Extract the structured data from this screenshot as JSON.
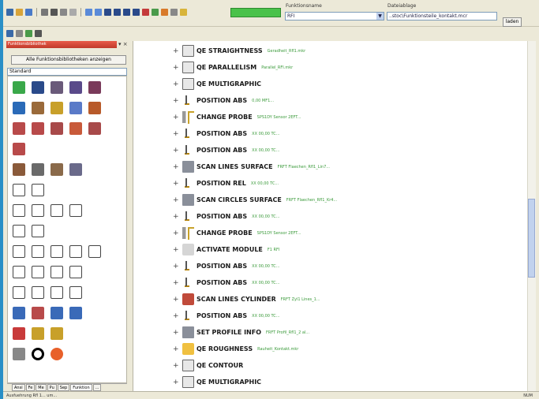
{
  "toolbar": {
    "field1_label": "Funktionsname",
    "field1_value": "RFI",
    "field2_label": "Dateiablage",
    "field2_value": "..stoc\\Funktionsteile_kontakt.mcr",
    "button_label": "laden"
  },
  "left_panel": {
    "title": "Funktionsbibliothek",
    "show_button": "Alle Funktionsbibliotheken anzeigen",
    "combo_value": "Standard",
    "tabs": [
      "Ansi",
      "Fe",
      "Me",
      "Pu",
      "Sep",
      "Funktion",
      "..."
    ]
  },
  "tree_rows": [
    {
      "label": "QE STRAIGHTNESS",
      "sub": "Geradheit_Rfl1.mkr",
      "icon": "box"
    },
    {
      "label": "QE PARALLELISM",
      "sub": "Parallel_RFI.mkr",
      "icon": "box"
    },
    {
      "label": "QE MULTIGRAPHIC",
      "sub": "",
      "icon": "box"
    },
    {
      "label": "POSITION ABS",
      "sub": "0,00 MF1...",
      "icon": "pos"
    },
    {
      "label": "CHANGE PROBE",
      "sub": "SPS1DY Sensor 2EFT...",
      "icon": "probe"
    },
    {
      "label": "POSITION ABS",
      "sub": "XX 00,00 TC...",
      "icon": "pos"
    },
    {
      "label": "POSITION ABS",
      "sub": "XX 00,00 TC...",
      "icon": "pos"
    },
    {
      "label": "SCAN LINES SURFACE",
      "sub": "FRFT Flaechen_Rfl1_Lin7...",
      "icon": "img"
    },
    {
      "label": "POSITION REL",
      "sub": "XX 00,00 TC...",
      "icon": "pos"
    },
    {
      "label": "SCAN CIRCLES SURFACE",
      "sub": "FRFT Flaechen_Rfl1_Kr4...",
      "icon": "img"
    },
    {
      "label": "POSITION ABS",
      "sub": "XX 00,00 TC...",
      "icon": "pos"
    },
    {
      "label": "CHANGE PROBE",
      "sub": "SPS1DY Sensor 2EFT...",
      "icon": "probe"
    },
    {
      "label": "ACTIVATE MODULE",
      "sub": "F1 RFI",
      "icon": "modul"
    },
    {
      "label": "POSITION ABS",
      "sub": "XX 00,00 TC...",
      "icon": "pos"
    },
    {
      "label": "POSITION ABS",
      "sub": "XX 00,00 TC...",
      "icon": "pos"
    },
    {
      "label": "SCAN LINES CYLINDER",
      "sub": "FRFT Zyl1 Lines_1...",
      "icon": "red"
    },
    {
      "label": "POSITION ABS",
      "sub": "XX 00,00 TC...",
      "icon": "pos"
    },
    {
      "label": "SET PROFILE INFO",
      "sub": "FRFT Profil_Rfl1_2 al...",
      "icon": "img"
    },
    {
      "label": "QE ROUGHNESS",
      "sub": "Rauheit_Kontakt.mkr",
      "icon": "robot"
    },
    {
      "label": "QE CONTOUR",
      "sub": "",
      "icon": "box"
    },
    {
      "label": "QE MULTIGRAPHIC",
      "sub": "",
      "icon": "box"
    }
  ],
  "statusbar": {
    "left": "Ausfuehrung Rfl 1... um...",
    "right": "NUM"
  }
}
